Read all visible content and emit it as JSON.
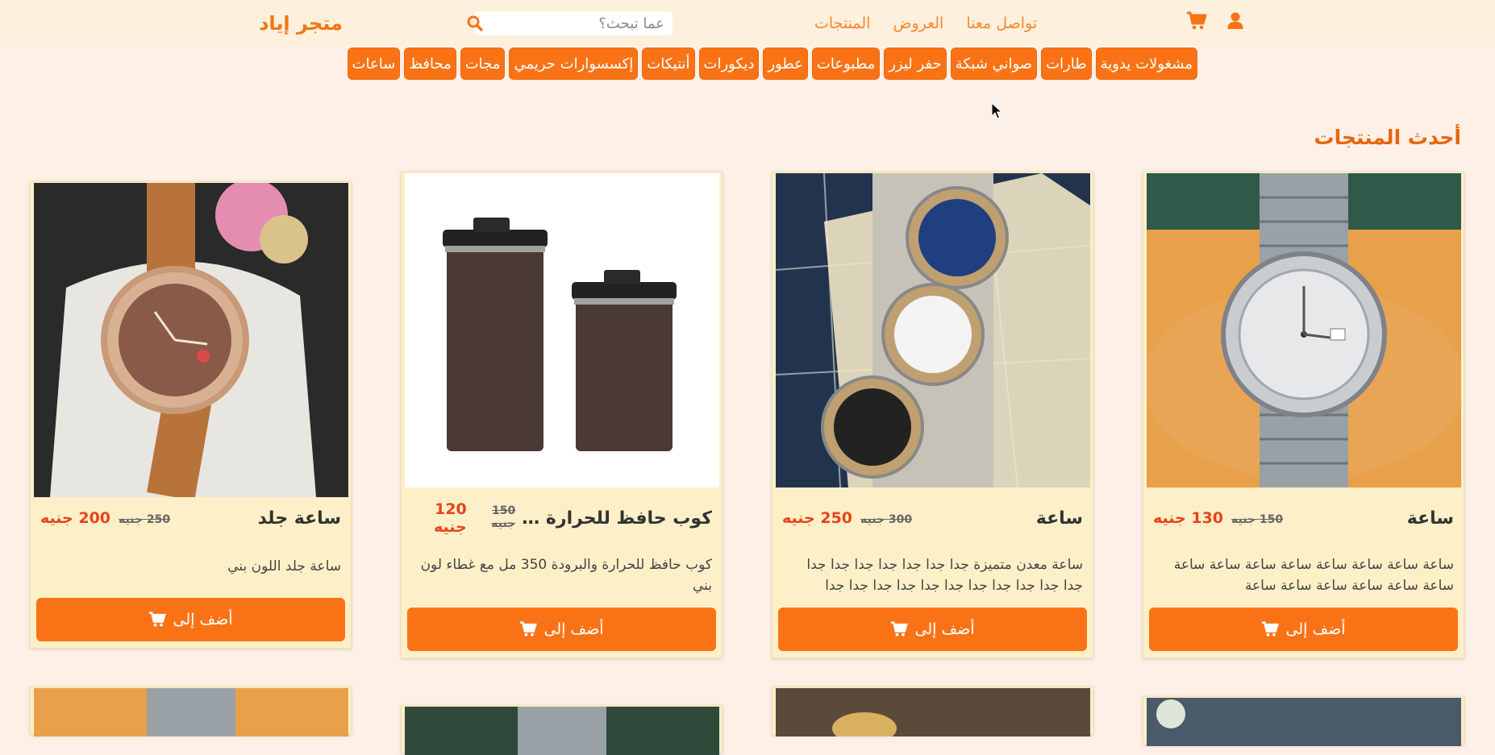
{
  "navbar": {
    "brand": "متجر إياد",
    "search_placeholder": "عما تبحث؟",
    "links": [
      "تواصل معنا",
      "العروض",
      "المنتجات"
    ],
    "icons": [
      "user-icon",
      "cart-icon",
      "search-icon"
    ]
  },
  "categories": [
    "مشغولات يدوية",
    "طارات",
    "صواني شبكة",
    "حفر ليزر",
    "مطبوعات",
    "عطور",
    "ديكورات",
    "أنتيكات",
    "إكسسوارات حريمي",
    "مجات",
    "محافظ",
    "ساعات"
  ],
  "section": {
    "title": "أحدث المنتجات"
  },
  "products": [
    {
      "name": "ساعة",
      "old_price": "150 جنيه",
      "new_price": "130 جنيه",
      "desc": "ساعة ساعة ساعة ساعة ساعة ساعة ساعة ساعة ساعة ساعة ساعة ساعة ساعة ساعة",
      "button": "أضف إلى"
    },
    {
      "name": "ساعة",
      "old_price": "300 جنيه",
      "new_price": "250 جنيه",
      "desc": "ساعة معدن متميزة جدا جدا جدا جدا جدا جدا جدا جدا جدا جدا جدا جدا جدا جدا جدا جدا جدا جدا",
      "button": "أضف إلى"
    },
    {
      "name": "كوب حافظ للحرارة والبرودة",
      "old_price": "150 جنيه",
      "new_price": "120 جنيه",
      "desc": "كوب حافظ للحرارة والبرودة 350 مل مع غطاء لون بني",
      "button": "أضف إلى"
    },
    {
      "name": "ساعة جلد",
      "old_price": "250 جنيه",
      "new_price": "200 جنيه",
      "desc": "ساعة جلد اللون بني",
      "button": "أضف إلى"
    }
  ],
  "colors": {
    "accent": "#f97316",
    "page_bg": "#fdf0e6",
    "nav_bg": "#fdf0dc",
    "card_bg": "#fdf0c8",
    "price": "#e8431c"
  }
}
